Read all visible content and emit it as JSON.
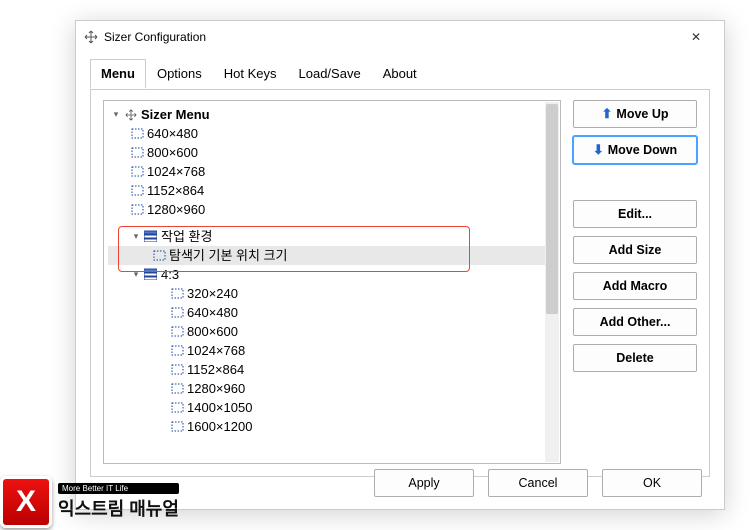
{
  "window": {
    "title": "Sizer Configuration"
  },
  "tabs": [
    {
      "label": "Menu",
      "active": true
    },
    {
      "label": "Options"
    },
    {
      "label": "Hot Keys"
    },
    {
      "label": "Load/Save"
    },
    {
      "label": "About"
    }
  ],
  "tree": {
    "root": "Sizer Menu",
    "group1_sizes": [
      "640×480",
      "800×600",
      "1024×768",
      "1152×864",
      "1280×960"
    ],
    "custom_group": {
      "name": "작업 환경",
      "child": "탐색기 기본 위치 크기"
    },
    "ratio_group": {
      "name": "4:3",
      "sizes": [
        "320×240",
        "640×480",
        "800×600",
        "1024×768",
        "1152×864",
        "1280×960",
        "1400×1050",
        "1600×1200"
      ]
    },
    "partial_row": "1"
  },
  "side_buttons": {
    "move_up": "Move Up",
    "move_down": "Move Down",
    "edit": "Edit...",
    "add_size": "Add Size",
    "add_macro": "Add Macro",
    "add_other": "Add Other...",
    "delete": "Delete"
  },
  "footer": {
    "apply": "Apply",
    "cancel": "Cancel",
    "ok": "OK"
  },
  "watermark": {
    "logo_letter": "X",
    "tagline": "More Better IT Life",
    "brand": "익스트림 매뉴얼"
  }
}
